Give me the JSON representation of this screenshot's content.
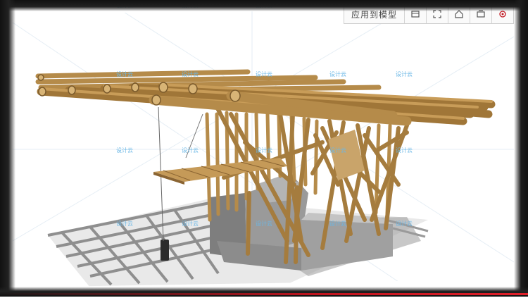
{
  "toolbar": {
    "title": "应用到模型",
    "buttons": [
      {
        "name": "model-icon",
        "label": "model"
      },
      {
        "name": "expand-icon",
        "label": "expand"
      },
      {
        "name": "home-icon",
        "label": "home"
      },
      {
        "name": "component-icon",
        "label": "component"
      },
      {
        "name": "settings-icon",
        "label": "settings"
      }
    ]
  },
  "watermark": {
    "text": "设计云"
  },
  "colors": {
    "bamboo": "#b58b4a",
    "bamboo_dark": "#7a5a2c",
    "stone": "#8a8a8a",
    "shadow": "#8f8f8f",
    "watermark": "#6ab7e6",
    "accent": "#c0141e"
  }
}
